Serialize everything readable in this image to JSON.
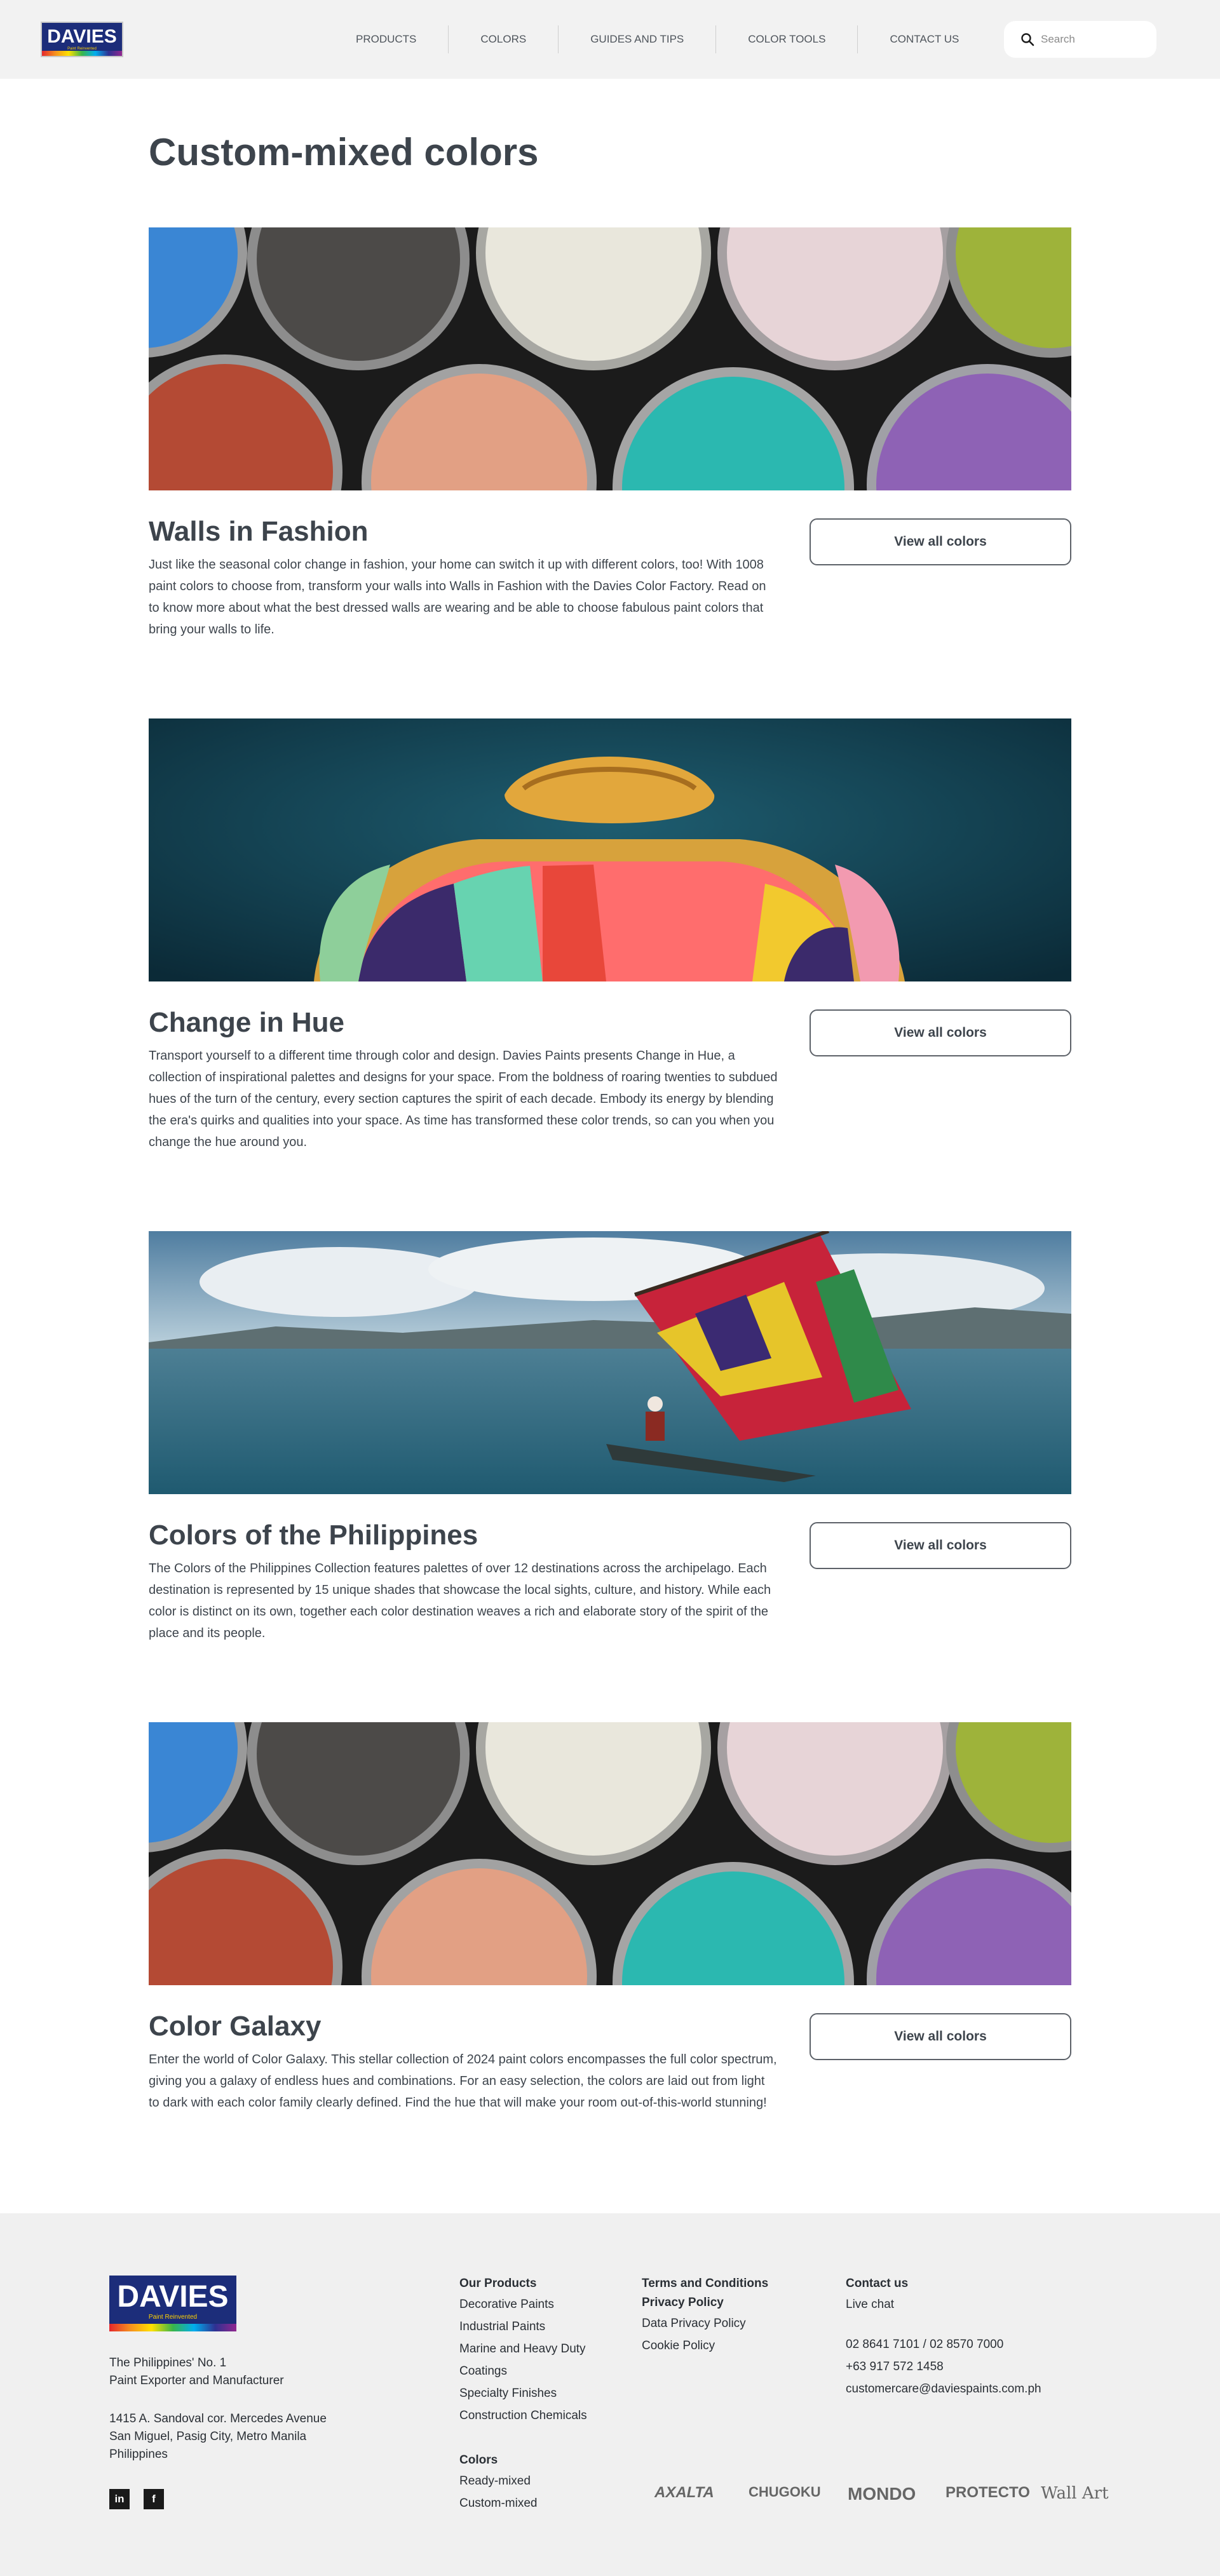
{
  "header": {
    "logo_text": "DAVIES",
    "logo_tag": "Paint Reinvented",
    "nav": [
      "PRODUCTS",
      "COLORS",
      "GUIDES AND TIPS",
      "COLOR TOOLS",
      "CONTACT US"
    ],
    "search_placeholder": "Search"
  },
  "main": {
    "title": "Custom-mixed colors",
    "button_label": "View all colors",
    "sections": [
      {
        "title": "Walls in Fashion",
        "desc": "Just like the seasonal color change in fashion, your home can switch it up with different colors, too! With 1008 paint colors to choose from, transform your walls into Walls in Fashion with the Davies Color Factory. Read on to know more about what the best dressed walls are wearing and be able to choose fabulous paint colors that bring your walls to life."
      },
      {
        "title": "Change in Hue",
        "desc": "Transport yourself to a different time through color and design. Davies Paints presents Change in Hue, a collection of inspirational palettes and designs for your space. From the boldness of roaring twenties to subdued hues of the turn of the century, every section captures the spirit of each decade. Embody its energy by blending the era's quirks and qualities into your space. As time has transformed these color trends, so can you when you change the hue around you."
      },
      {
        "title": "Colors of the Philippines",
        "desc": "The Colors of the Philippines Collection features palettes of over 12 destinations across the archipelago. Each destination is represented by 15 unique shades that showcase the local sights, culture, and history. While each color is distinct on its own, together each color destination weaves a rich and elaborate story of the spirit of the place and its people."
      },
      {
        "title": "Color Galaxy",
        "desc": "Enter the world of Color Galaxy. This stellar collection of 2024 paint colors encompasses the full color spectrum, giving you a galaxy of endless hues and combinations. For an easy selection, the colors are laid out from light to dark with each color family clearly defined. Find the hue that will make your room out-of-this-world stunning!"
      }
    ]
  },
  "footer": {
    "logo_text": "DAVIES",
    "logo_tag": "Paint Reinvented",
    "tagline": [
      "The Philippines' No. 1",
      "Paint Exporter and Manufacturer"
    ],
    "address": [
      "1415 A. Sandoval cor. Mercedes Avenue",
      "San Miguel, Pasig City, Metro Manila",
      "Philippines"
    ],
    "social": [
      "in",
      "f"
    ],
    "products": {
      "heading": "Our Products",
      "items": [
        "Decorative Paints",
        "Industrial Paints",
        "Marine and Heavy Duty Coatings",
        "Specialty Finishes",
        "Construction Chemicals"
      ]
    },
    "colors": {
      "heading": "Colors",
      "items": [
        "Ready-mixed",
        "Custom-mixed"
      ]
    },
    "legal": {
      "heading1": "Terms and Conditions",
      "heading2": "Privacy Policy",
      "items": [
        "Data Privacy Policy",
        "Cookie Policy"
      ]
    },
    "contact": {
      "heading": "Contact us",
      "live_chat": "Live chat",
      "phone1": "02 8641 7101 / 02 8570 7000",
      "phone2": "+63 917 572 1458",
      "email": "customercare@daviespaints.com.ph"
    },
    "brands": [
      "AXALTA",
      "CHUGOKU",
      "MONDO",
      "PROTECTO",
      "Wall Art"
    ]
  }
}
